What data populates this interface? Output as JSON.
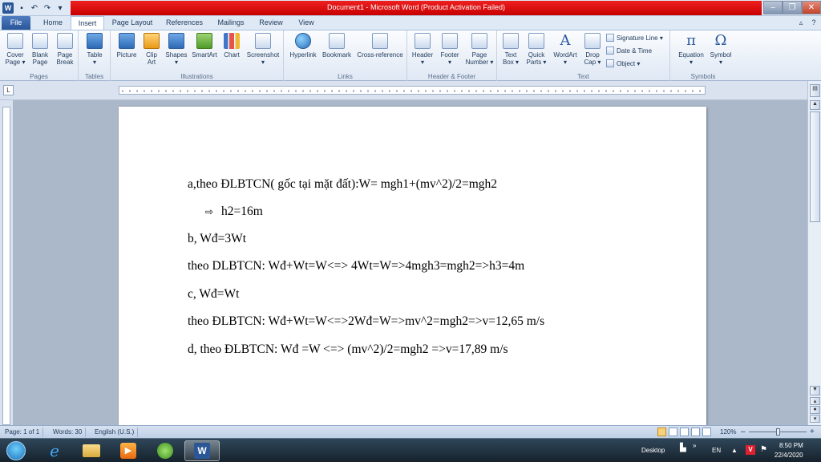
{
  "window": {
    "title": "Document1  -  Microsoft Word (Product Activation Failed)",
    "app_icon": "W",
    "minimize": "–",
    "restore": "❐",
    "close": "✕"
  },
  "tabs": {
    "file": "File",
    "home": "Home",
    "insert": "Insert",
    "page_layout": "Page Layout",
    "references": "References",
    "mailings": "Mailings",
    "review": "Review",
    "view": "View"
  },
  "ribbon": {
    "pages": {
      "label": "Pages",
      "cover": "Cover\nPage ▾",
      "blank": "Blank\nPage",
      "break": "Page\nBreak"
    },
    "tables": {
      "label": "Tables",
      "table": "Table\n▾"
    },
    "illustrations": {
      "label": "Illustrations",
      "picture": "Picture",
      "clipart": "Clip\nArt",
      "shapes": "Shapes\n▾",
      "smartart": "SmartArt",
      "chart": "Chart",
      "screenshot": "Screenshot\n▾"
    },
    "links": {
      "label": "Links",
      "hyperlink": "Hyperlink",
      "bookmark": "Bookmark",
      "crossref": "Cross-reference"
    },
    "header_footer": {
      "label": "Header & Footer",
      "header": "Header\n▾",
      "footer": "Footer\n▾",
      "page_number": "Page\nNumber ▾"
    },
    "text": {
      "label": "Text",
      "textbox": "Text\nBox ▾",
      "quickparts": "Quick\nParts ▾",
      "wordart": "WordArt\n▾",
      "dropcap": "Drop\nCap ▾",
      "signature": "Signature Line ▾",
      "datetime": "Date & Time",
      "object": "Object ▾"
    },
    "symbols": {
      "label": "Symbols",
      "equation": "Equation\n▾",
      "symbol": "Symbol\n▾",
      "pi": "π",
      "omega": "Ω"
    }
  },
  "document": {
    "lines": [
      "a,theo ĐLBTCN( gốc tại mặt đất):W= mgh1+(mv^2)/2=mgh2",
      "h2=16m",
      "b, Wđ=3Wt",
      "theo DLBTCN: Wđ+Wt=W<=>  4Wt=W=>4mgh3=mgh2=>h3=4m",
      "c,  Wđ=Wt",
      "theo ĐLBTCN: Wđ+Wt=W<=>2Wđ=W=>mv^2=mgh2=>v=12,65  m/s",
      "d, theo ĐLBTCN:  Wđ =W <=> (mv^2)/2=mgh2  =>v=17,89  m/s"
    ],
    "arrow_glyph": "⇨"
  },
  "status": {
    "page": "Page: 1 of 1",
    "words": "Words: 30",
    "language": "English (U.S.)",
    "zoom": "120%",
    "zoom_minus": "–",
    "zoom_plus": "+"
  },
  "taskbar": {
    "desktop": "Desktop",
    "lang": "EN",
    "time": "8:50 PM",
    "date": "22/4/2020"
  },
  "colors": {
    "title_bar_accent": "#d40000",
    "word_blue": "#2b5797"
  }
}
